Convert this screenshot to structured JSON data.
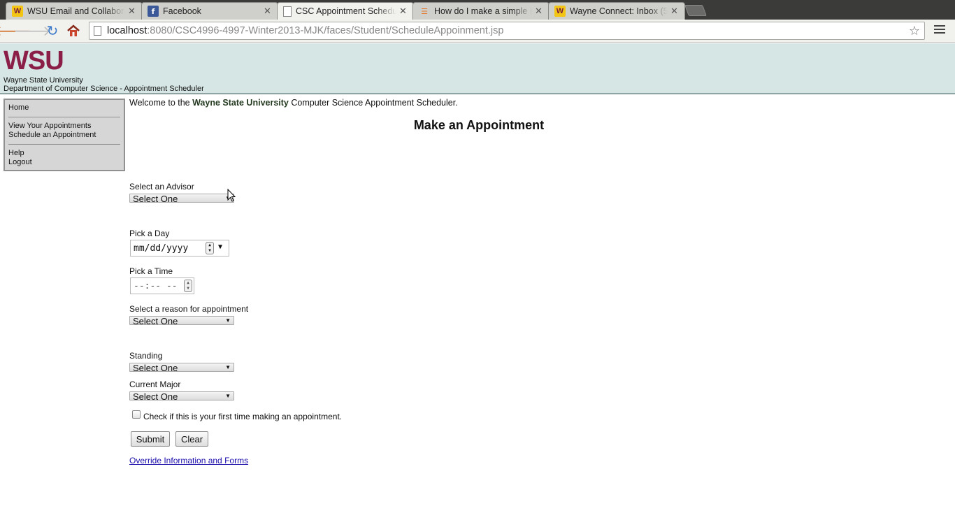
{
  "browser": {
    "tabs": [
      {
        "title": "WSU Email and Collaborat",
        "icon": "wsu-favicon"
      },
      {
        "title": "Facebook",
        "icon": "facebook-favicon"
      },
      {
        "title": "CSC Appointment Schedu",
        "icon": "page-favicon",
        "active": true
      },
      {
        "title": "How do I make a simple H",
        "icon": "stackoverflow-favicon"
      },
      {
        "title": "Wayne Connect: Inbox (5",
        "icon": "wsu-favicon"
      }
    ],
    "url_host": "localhost",
    "url_path": ":8080/CSC4996-4997-Winter2013-MJK/faces/Student/ScheduleAppoinment.jsp"
  },
  "header": {
    "logo": "WSU",
    "university": "Wayne State University",
    "department": "Department of Computer Science - Appointment Scheduler",
    "logo_color": "#8b1e47",
    "background": "#d6e6e4"
  },
  "sidebar": {
    "home": "Home",
    "view_appointments": "View Your Appointments",
    "schedule_appointment": "Schedule an Appointment",
    "help": "Help",
    "logout": "Logout"
  },
  "main": {
    "welcome_prefix": "Welcome to the ",
    "welcome_university": "Wayne State University",
    "welcome_suffix": " Computer Science Appointment Scheduler.",
    "heading": "Make an Appointment",
    "advisor_label": "Select an Advisor",
    "advisor_value": "Select One",
    "day_label": "Pick a Day",
    "day_placeholder": "mm/dd/yyyy",
    "time_label": "Pick a Time",
    "time_placeholder": "--:-- --",
    "reason_label": "Select a reason for appointment",
    "reason_value": "Select One",
    "standing_label": "Standing",
    "standing_value": "Select One",
    "major_label": "Current Major",
    "major_value": "Select One",
    "first_time_label": "Check if this is your first time making an appointment.",
    "submit_label": "Submit",
    "clear_label": "Clear",
    "override_link": "Override Information and Forms"
  }
}
